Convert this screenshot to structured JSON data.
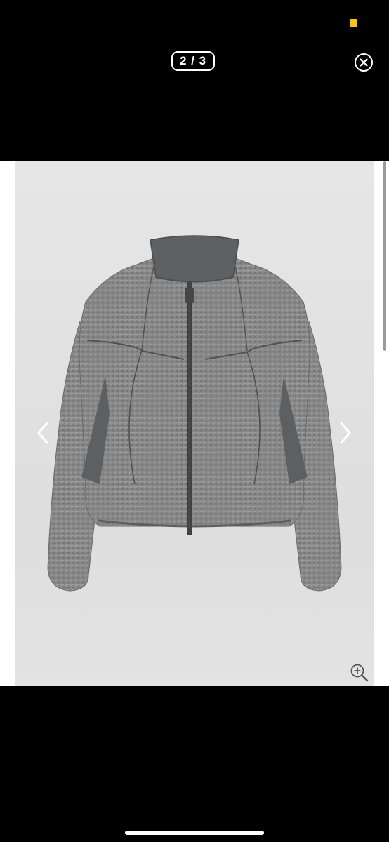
{
  "viewer": {
    "page_indicator": "2 / 3",
    "close_icon": "close-circle-icon",
    "prev_icon": "chevron-left-icon",
    "next_icon": "chevron-right-icon",
    "zoom_icon": "zoom-in-icon"
  },
  "colors": {
    "background": "#000000",
    "recording_dot": "#f5c518",
    "photo_background": "#e2e2e2"
  }
}
